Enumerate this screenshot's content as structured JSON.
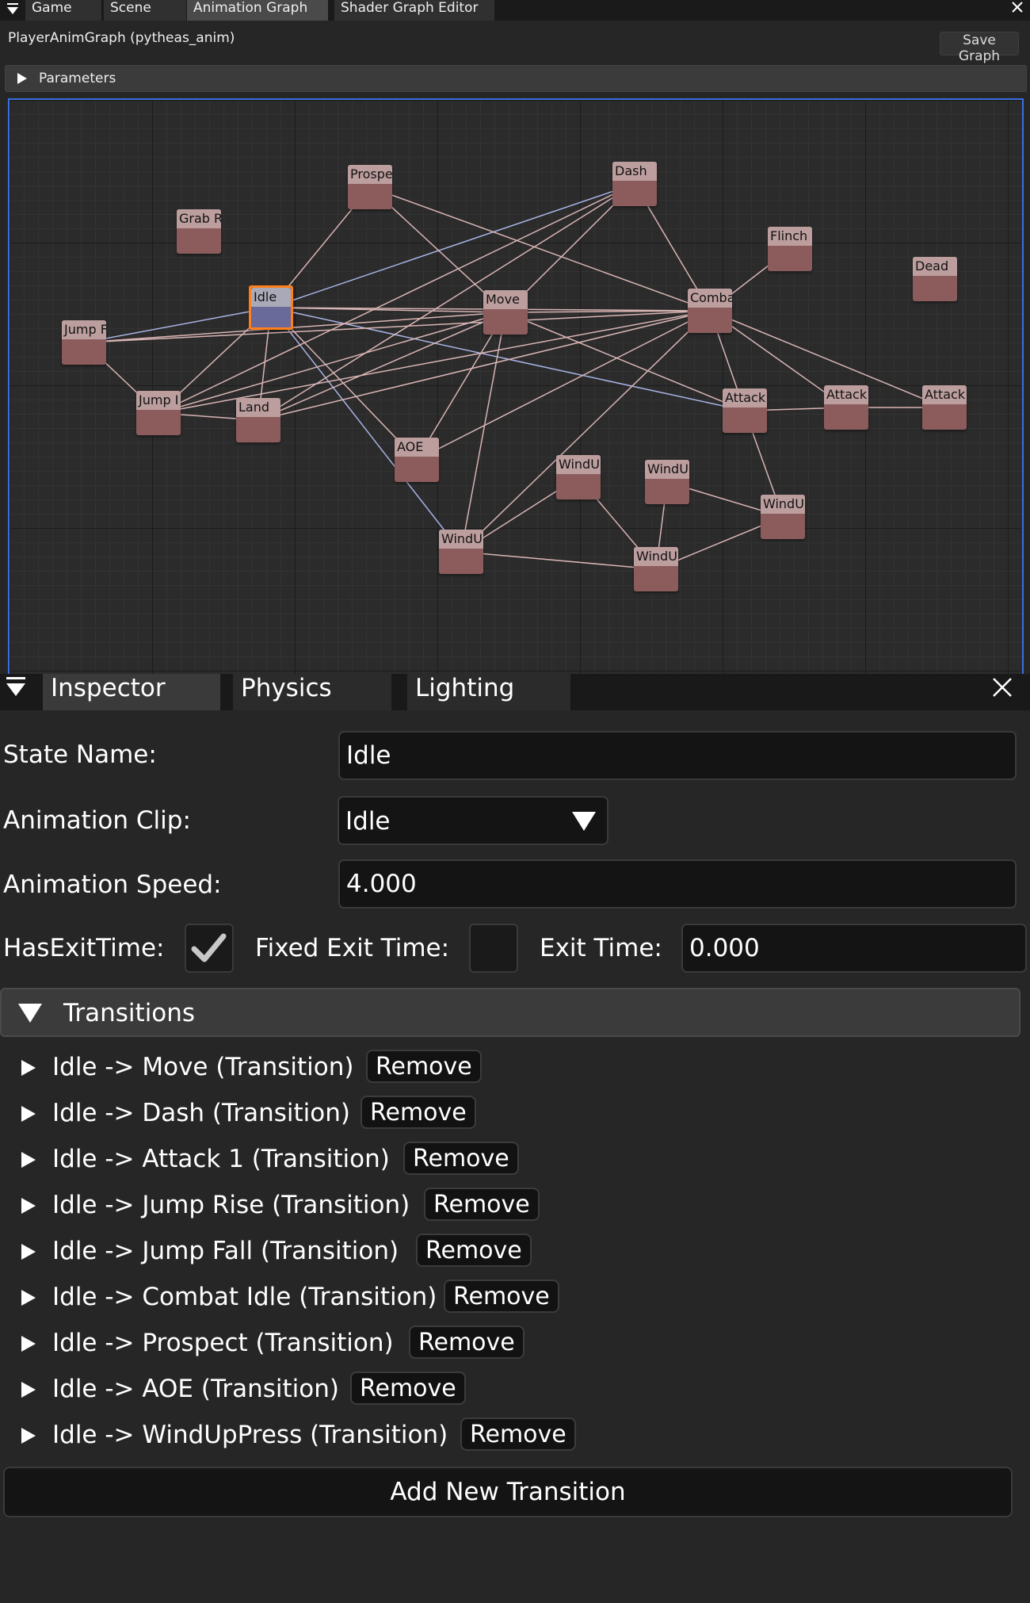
{
  "top_tabs": [
    "Game",
    "Scene",
    "Animation Graph",
    "Shader Graph Editor"
  ],
  "graph": {
    "title": "PlayerAnimGraph (pytheas_anim)",
    "save_label": "Save Graph",
    "params_label": "Parameters",
    "nodes": [
      {
        "label": "Idle",
        "selected": true
      },
      {
        "label": "Prospe"
      },
      {
        "label": "Grab R"
      },
      {
        "label": "Dash"
      },
      {
        "label": "Flinch"
      },
      {
        "label": "Dead"
      },
      {
        "label": "Move"
      },
      {
        "label": "Comba"
      },
      {
        "label": "Jump F"
      },
      {
        "label": "Jump I"
      },
      {
        "label": "Land"
      },
      {
        "label": "AOE"
      },
      {
        "label": "Attack"
      },
      {
        "label": "Attack"
      },
      {
        "label": "Attack"
      },
      {
        "label": "WindU"
      },
      {
        "label": "WindU"
      },
      {
        "label": "WindU"
      },
      {
        "label": "WindU"
      },
      {
        "label": "WindU"
      }
    ]
  },
  "inspector": {
    "tabs": [
      "Inspector",
      "Physics",
      "Lighting"
    ],
    "state_name_label": "State Name:",
    "state_name_value": "Idle",
    "clip_label": "Animation Clip:",
    "clip_value": "Idle",
    "speed_label": "Animation Speed:",
    "speed_value": "4.000",
    "has_exit_label": "HasExitTime:",
    "has_exit_checked": true,
    "fixed_exit_label": "Fixed Exit Time:",
    "fixed_exit_checked": false,
    "exit_time_label": "Exit Time:",
    "exit_time_value": "0.000",
    "transitions_label": "Transitions",
    "remove_label": "Remove",
    "transitions": [
      "Idle -> Move (Transition)",
      "Idle -> Dash (Transition)",
      "Idle -> Attack 1 (Transition)",
      "Idle -> Jump Rise (Transition)",
      "Idle -> Jump Fall (Transition)",
      "Idle -> Combat Idle (Transition)",
      "Idle -> Prospect (Transition)",
      "Idle -> AOE (Transition)",
      "Idle -> WindUpPress (Transition)"
    ],
    "add_transition_label": "Add New Transition"
  },
  "colors": {
    "accent_blue": "#3a6fe0",
    "selected_node_border": "#ff7f1a",
    "node_body": "#8c5c5c",
    "node_header": "#bd9e9e",
    "edge_pink": "#d9b4b4",
    "edge_blue": "#a9b4e6"
  }
}
